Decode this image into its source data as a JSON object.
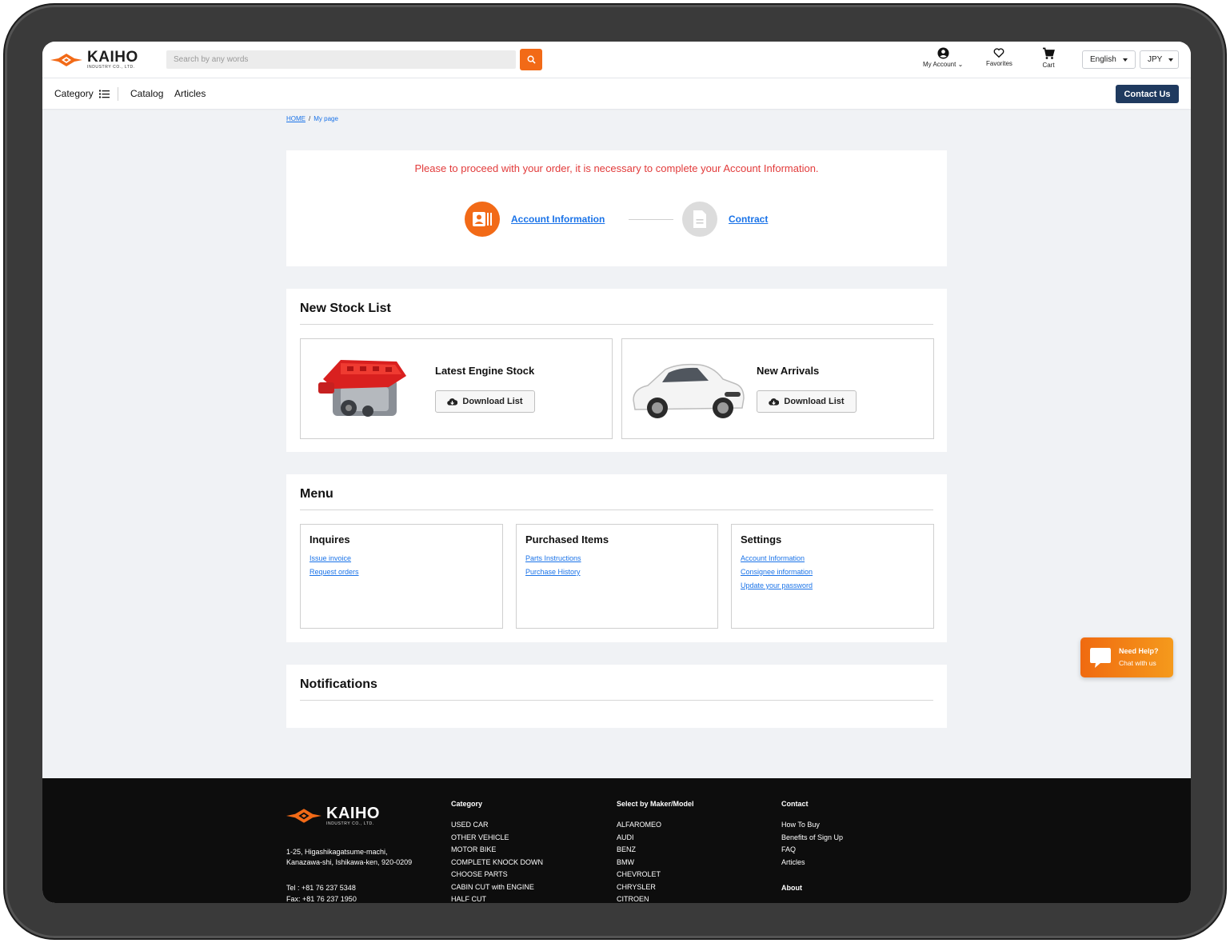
{
  "brand": {
    "name": "KAIHO",
    "tagline": "INDUSTRY CO., LTD.",
    "accent": "#f26a17",
    "navy": "#1f3a5f"
  },
  "header": {
    "search_placeholder": "Search by any words",
    "my_account": "My Account",
    "favorites": "Favorites",
    "cart": "Cart",
    "language": "English",
    "currency": "JPY"
  },
  "nav": {
    "category": "Category",
    "catalog": "Catalog",
    "articles": "Articles",
    "contact": "Contact Us"
  },
  "breadcrumb": {
    "home": "HOME",
    "sep": "/",
    "current": "My page"
  },
  "account_notice": {
    "message": "Please to proceed with your order, it is necessary to complete your Account Information.",
    "step1": "Account Information",
    "step2": "Contract"
  },
  "stock": {
    "title": "New Stock List",
    "items": [
      {
        "title": "Latest Engine Stock",
        "button": "Download List"
      },
      {
        "title": "New Arrivals",
        "button": "Download List"
      }
    ]
  },
  "menu": {
    "title": "Menu",
    "groups": [
      {
        "title": "Inquires",
        "links": [
          "Issue invoice",
          "Request orders"
        ]
      },
      {
        "title": "Purchased Items",
        "links": [
          "Parts Instructions",
          "Purchase History"
        ]
      },
      {
        "title": "Settings",
        "links": [
          "Account Information",
          "Consignee information",
          "Update your password"
        ]
      }
    ]
  },
  "notifications": {
    "title": "Notifications"
  },
  "chat": {
    "title": "Need Help?",
    "subtitle": "Chat with us"
  },
  "footer": {
    "address_line1": "1-25, Higashikagatsume-machi,",
    "address_line2": "Kanazawa-shi, Ishikawa-ken, 920-0209",
    "tel": "Tel : +81 76 237 5348",
    "fax": "Fax: +81 76 237 1950",
    "category": {
      "title": "Category",
      "items": [
        "USED CAR",
        "OTHER VEHICLE",
        "MOTOR BIKE",
        "COMPLETE KNOCK DOWN",
        "CHOOSE PARTS",
        "CABIN CUT with ENGINE",
        "HALF CUT"
      ]
    },
    "maker": {
      "title": "Select by Maker/Model",
      "items": [
        "ALFAROMEO",
        "AUDI",
        "BENZ",
        "BMW",
        "CHEVROLET",
        "CHRYSLER",
        "CITROEN"
      ]
    },
    "contact": {
      "title": "Contact",
      "items": [
        "How To Buy",
        "Benefits of Sign Up",
        "FAQ",
        "Articles"
      ]
    },
    "about": "About"
  }
}
